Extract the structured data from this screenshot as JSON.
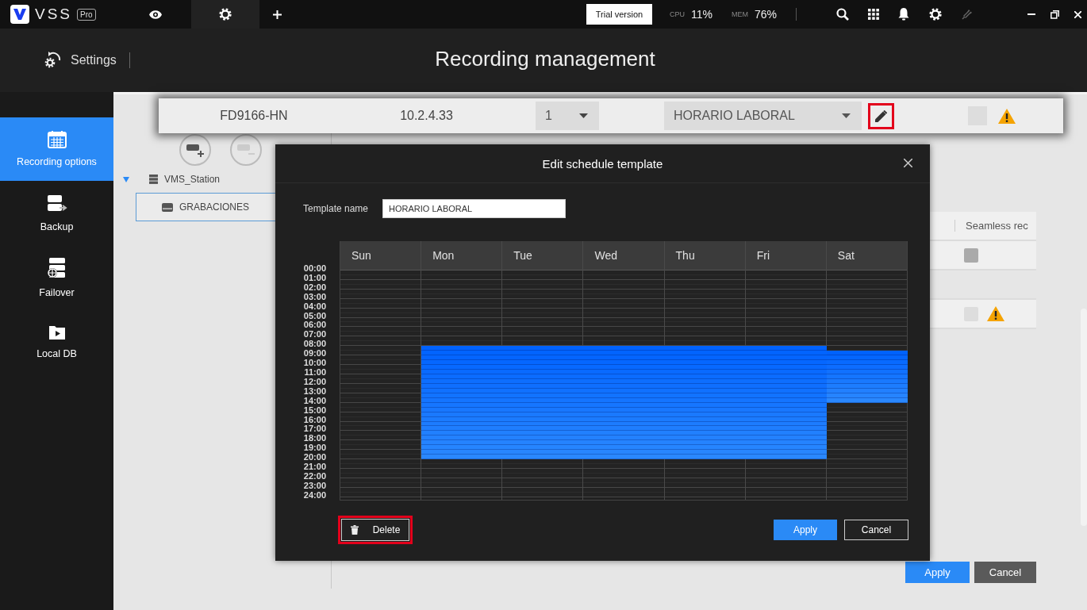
{
  "app": {
    "logo": "VSS",
    "edition": "Pro"
  },
  "tabs": [
    {
      "kind": "live",
      "selected": false
    },
    {
      "kind": "settings",
      "selected": true
    }
  ],
  "status": {
    "trial": "Trial version",
    "cpu_label": "CPU",
    "cpu": "11%",
    "mem_label": "MEM",
    "mem": "76%"
  },
  "header": {
    "section": "Settings",
    "title": "Recording management"
  },
  "sidebar": [
    {
      "label": "Recording options",
      "kind": "calendar",
      "selected": true
    },
    {
      "label": "Backup",
      "kind": "backup",
      "selected": false
    },
    {
      "label": "Failover",
      "kind": "failover",
      "selected": false
    },
    {
      "label": "Local DB",
      "kind": "localdb",
      "selected": false
    }
  ],
  "tree": [
    {
      "label": "VMS_Station",
      "expanded": true,
      "selected": false,
      "children": [
        {
          "label": "GRABACIONES",
          "selected": true
        }
      ]
    }
  ],
  "table": {
    "column_header": "Seamless rec",
    "rows": [
      {
        "kind": "checkbox",
        "checked": false,
        "disabled": false,
        "warning": false
      },
      {
        "kind": "blank"
      },
      {
        "kind": "checkbox",
        "checked": false,
        "disabled": true,
        "warning": true
      }
    ]
  },
  "device_row": {
    "name": "FD9166-HN",
    "ip": "10.2.4.33",
    "stream": "1",
    "schedule": "HORARIO LABORAL",
    "edit_highlighted": true,
    "seamless_checked": false,
    "seamless_disabled": true,
    "warning": true
  },
  "dialog": {
    "title": "Edit schedule template",
    "name_label": "Template name",
    "name_value": "HORARIO LABORAL",
    "hours": [
      "00:00",
      "01:00",
      "02:00",
      "03:00",
      "04:00",
      "05:00",
      "06:00",
      "07:00",
      "08:00",
      "09:00",
      "10:00",
      "11:00",
      "12:00",
      "13:00",
      "14:00",
      "15:00",
      "16:00",
      "17:00",
      "18:00",
      "19:00",
      "20:00",
      "21:00",
      "22:00",
      "23:00",
      "24:00"
    ],
    "days": [
      {
        "label": "Sun",
        "slots": [
          false,
          false,
          false,
          false,
          false,
          false,
          false,
          false,
          false,
          false,
          false,
          false,
          false,
          false,
          false,
          false,
          false,
          false,
          false,
          false,
          false,
          false,
          false,
          false,
          false,
          false,
          false,
          false,
          false,
          false,
          false,
          false,
          false,
          false,
          false,
          false,
          false,
          false,
          false,
          false,
          false,
          false,
          false,
          false,
          false,
          false,
          false,
          false
        ]
      },
      {
        "label": "Mon",
        "slots": [
          false,
          false,
          false,
          false,
          false,
          false,
          false,
          false,
          false,
          false,
          false,
          false,
          false,
          false,
          false,
          false,
          true,
          true,
          true,
          true,
          true,
          true,
          true,
          true,
          true,
          true,
          true,
          true,
          true,
          true,
          true,
          true,
          true,
          true,
          true,
          true,
          true,
          true,
          true,
          true,
          false,
          false,
          false,
          false,
          false,
          false,
          false,
          false
        ]
      },
      {
        "label": "Tue",
        "slots": [
          false,
          false,
          false,
          false,
          false,
          false,
          false,
          false,
          false,
          false,
          false,
          false,
          false,
          false,
          false,
          false,
          true,
          true,
          true,
          true,
          true,
          true,
          true,
          true,
          true,
          true,
          true,
          true,
          true,
          true,
          true,
          true,
          true,
          true,
          true,
          true,
          true,
          true,
          true,
          true,
          false,
          false,
          false,
          false,
          false,
          false,
          false,
          false
        ]
      },
      {
        "label": "Wed",
        "slots": [
          false,
          false,
          false,
          false,
          false,
          false,
          false,
          false,
          false,
          false,
          false,
          false,
          false,
          false,
          false,
          false,
          true,
          true,
          true,
          true,
          true,
          true,
          true,
          true,
          true,
          true,
          true,
          true,
          true,
          true,
          true,
          true,
          true,
          true,
          true,
          true,
          true,
          true,
          true,
          true,
          false,
          false,
          false,
          false,
          false,
          false,
          false,
          false
        ]
      },
      {
        "label": "Thu",
        "slots": [
          false,
          false,
          false,
          false,
          false,
          false,
          false,
          false,
          false,
          false,
          false,
          false,
          false,
          false,
          false,
          false,
          true,
          true,
          true,
          true,
          true,
          true,
          true,
          true,
          true,
          true,
          true,
          true,
          true,
          true,
          true,
          true,
          true,
          true,
          true,
          true,
          true,
          true,
          true,
          true,
          false,
          false,
          false,
          false,
          false,
          false,
          false,
          false
        ]
      },
      {
        "label": "Fri",
        "slots": [
          false,
          false,
          false,
          false,
          false,
          false,
          false,
          false,
          false,
          false,
          false,
          false,
          false,
          false,
          false,
          false,
          true,
          true,
          true,
          true,
          true,
          true,
          true,
          true,
          true,
          true,
          true,
          true,
          true,
          true,
          true,
          true,
          true,
          true,
          true,
          true,
          true,
          true,
          true,
          true,
          false,
          false,
          false,
          false,
          false,
          false,
          false,
          false
        ]
      },
      {
        "label": "Sat",
        "slots": [
          false,
          false,
          false,
          false,
          false,
          false,
          false,
          false,
          false,
          false,
          false,
          false,
          false,
          false,
          false,
          false,
          false,
          true,
          true,
          true,
          true,
          true,
          true,
          true,
          true,
          true,
          true,
          true,
          false,
          false,
          false,
          false,
          false,
          false,
          false,
          false,
          false,
          false,
          false,
          false,
          false,
          false,
          false,
          false,
          false,
          false,
          false,
          false
        ]
      }
    ],
    "buttons": [
      {
        "label": "Delete",
        "kind": "delete",
        "highlighted": true
      },
      {
        "label": "Apply",
        "kind": "primary",
        "highlighted": false
      },
      {
        "label": "Cancel",
        "kind": "secondary",
        "highlighted": false
      }
    ]
  },
  "footer_buttons": [
    {
      "label": "Apply",
      "kind": "primary"
    },
    {
      "label": "Cancel",
      "kind": "secondary"
    }
  ]
}
